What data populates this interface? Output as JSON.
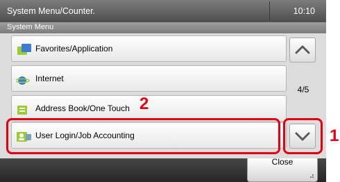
{
  "header": {
    "title": "System Menu/Counter.",
    "time": "10:10"
  },
  "subheader": {
    "title": "System Menu"
  },
  "menu_items": [
    {
      "label": "Favorites/Application",
      "icon": "favorites-app-icon"
    },
    {
      "label": "Internet",
      "icon": "internet-icon"
    },
    {
      "label": "Address Book/One Touch",
      "icon": "address-book-icon"
    },
    {
      "label": "User Login/Job Accounting",
      "icon": "user-login-icon"
    }
  ],
  "scroll": {
    "page_indicator": "4/5"
  },
  "footer": {
    "close_label": "Close"
  },
  "callouts": {
    "step1": "1",
    "step2": "2"
  },
  "colors": {
    "highlight": "#e3000f",
    "icon_green": "#9ccc34",
    "icon_blue": "#3a7bd5"
  }
}
